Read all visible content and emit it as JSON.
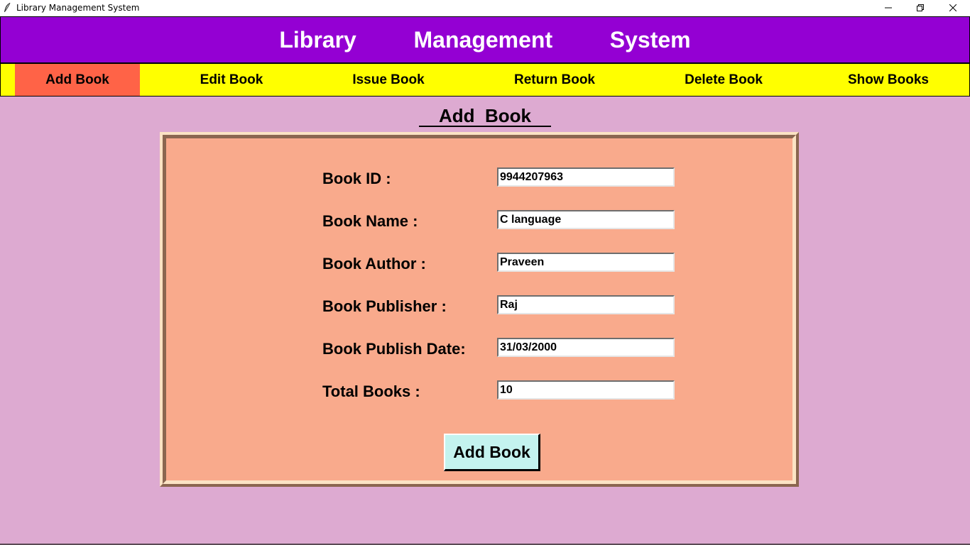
{
  "window": {
    "title": "Library Management System",
    "icon": "feather-icon",
    "controls": [
      "minimize-icon",
      "restore-icon",
      "close-icon"
    ]
  },
  "header": {
    "heading": "Library   Management   System"
  },
  "nav": {
    "tabs": [
      {
        "label": "Add Book",
        "active": true
      },
      {
        "label": "Edit Book",
        "active": false
      },
      {
        "label": "Issue Book",
        "active": false
      },
      {
        "label": "Return Book",
        "active": false
      },
      {
        "label": "Delete Book",
        "active": false
      },
      {
        "label": "Show Books",
        "active": false
      }
    ]
  },
  "form": {
    "title": "Add  Book",
    "fields": [
      {
        "label": "Book ID :",
        "value": "9944207963"
      },
      {
        "label": "Book Name :",
        "value": "C language"
      },
      {
        "label": "Book Author :",
        "value": "Praveen"
      },
      {
        "label": "Book Publisher :",
        "value": "Raj"
      },
      {
        "label": "Book Publish Date:",
        "value": "31/03/2000"
      },
      {
        "label": "Total Books :",
        "value": "10"
      }
    ],
    "submit_label": "Add Book"
  },
  "colors": {
    "background": "#ddaad1",
    "header": "#9400d3",
    "nav": "#ffff00",
    "active_tab": "#ff6347",
    "panel": "#f9aa8c",
    "button": "#c4f3ef"
  }
}
